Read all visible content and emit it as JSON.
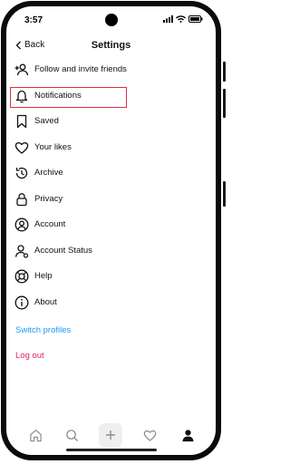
{
  "status_bar": {
    "time": "3:57",
    "icons": [
      "signal-icon",
      "wifi-icon",
      "battery-icon"
    ]
  },
  "header": {
    "back_label": "Back",
    "title": "Settings"
  },
  "menu": {
    "items": [
      {
        "label": "Follow and invite friends",
        "icon": "add-person-icon"
      },
      {
        "label": "Notifications",
        "icon": "bell-icon"
      },
      {
        "label": "Saved",
        "icon": "bookmark-icon"
      },
      {
        "label": "Your likes",
        "icon": "heart-icon"
      },
      {
        "label": "Archive",
        "icon": "archive-icon"
      },
      {
        "label": "Privacy",
        "icon": "lock-icon"
      },
      {
        "label": "Account",
        "icon": "account-icon"
      },
      {
        "label": "Account Status",
        "icon": "person-icon"
      },
      {
        "label": "Help",
        "icon": "lifebuoy-icon"
      },
      {
        "label": "About",
        "icon": "info-icon"
      }
    ]
  },
  "links": {
    "switch_profiles": "Switch profiles",
    "log_out": "Log out"
  },
  "bottom_nav": {
    "items": [
      "home-icon",
      "search-icon",
      "add-icon",
      "heart-icon",
      "profile-icon"
    ]
  },
  "colors": {
    "accent_link": "#1d9bf0",
    "logout": "#e0245e",
    "highlight": "#e0323a"
  }
}
